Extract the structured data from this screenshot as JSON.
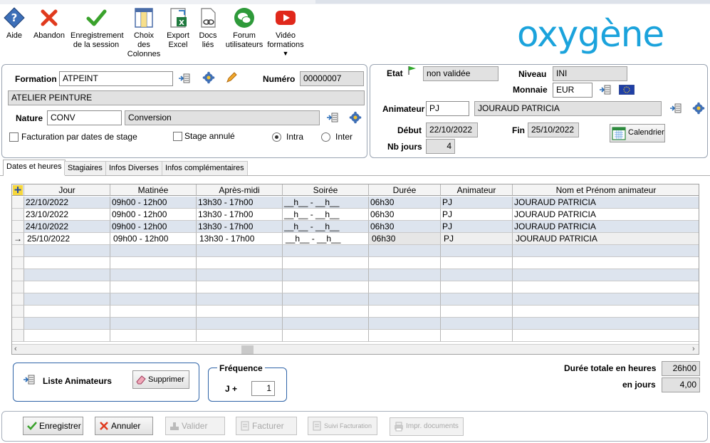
{
  "toolbar": {
    "items": [
      {
        "label": "Aide",
        "icon": "help-icon"
      },
      {
        "label": "Abandon",
        "icon": "close-icon"
      },
      {
        "label": "Enregistrement\nde la session",
        "icon": "check-icon"
      },
      {
        "label": "Choix\ndes\nColonnes",
        "icon": "columns-icon"
      },
      {
        "label": "Export\nExcel",
        "icon": "excel-icon"
      },
      {
        "label": "Docs\nliés",
        "icon": "linked-docs-icon"
      },
      {
        "label": "Forum\nutilisateurs",
        "icon": "forum-icon"
      },
      {
        "label": "Vidéo\nformations",
        "icon": "video-icon"
      }
    ],
    "logo": "oxygène"
  },
  "left_panel": {
    "formation_label": "Formation",
    "formation_value": "ATPEINT",
    "numero_label": "Numéro",
    "numero_value": "00000007",
    "formation_name": "ATELIER PEINTURE",
    "nature_label": "Nature",
    "nature_code": "CONV",
    "nature_name": "Conversion",
    "facturation_label": "Facturation par dates de stage",
    "stage_annule_label": "Stage annulé",
    "intra_label": "Intra",
    "inter_label": "Inter",
    "mode_selected": "Intra"
  },
  "right_panel": {
    "etat_label": "Etat",
    "etat_value": "non validée",
    "niveau_label": "Niveau",
    "niveau_value": "INI",
    "monnaie_label": "Monnaie",
    "monnaie_value": "EUR",
    "animateur_label": "Animateur",
    "animateur_code": "PJ",
    "animateur_name": "JOURAUD PATRICIA",
    "debut_label": "Début",
    "debut_value": "22/10/2022",
    "fin_label": "Fin",
    "fin_value": "25/10/2022",
    "calendrier_label": "Calendrier",
    "nbjours_label": "Nb jours",
    "nbjours_value": "4"
  },
  "tabs": [
    {
      "label": "Dates et heures",
      "active": true
    },
    {
      "label": "Stagiaires",
      "active": false
    },
    {
      "label": "Infos Diverses",
      "active": false
    },
    {
      "label": "Infos complémentaires",
      "active": false
    }
  ],
  "grid": {
    "columns": [
      "Jour",
      "Matinée",
      "Après-midi",
      "Soirée",
      "Durée",
      "Animateur",
      "Nom et Prénom animateur"
    ],
    "rows": [
      [
        "22/10/2022",
        "09h00 - 12h00",
        "13h30 - 17h00",
        "__h__ - __h__",
        "06h30",
        "PJ",
        "JOURAUD PATRICIA"
      ],
      [
        "23/10/2022",
        "09h00 - 12h00",
        "13h30 - 17h00",
        "__h__ - __h__",
        "06h30",
        "PJ",
        "JOURAUD PATRICIA"
      ],
      [
        "24/10/2022",
        "09h00 - 12h00",
        "13h30 - 17h00",
        "__h__ - __h__",
        "06h30",
        "PJ",
        "JOURAUD PATRICIA"
      ],
      [
        "25/10/2022",
        "09h00 - 12h00",
        "13h30 - 17h00",
        "__h__ - __h__",
        "06h30",
        "PJ",
        "JOURAUD PATRICIA"
      ]
    ],
    "current_row_indicator": "→"
  },
  "footer_panel": {
    "liste_animateurs_label": "Liste Animateurs",
    "supprimer_label": "Supprimer",
    "frequence_label": "Fréquence",
    "jplus_label": "J +",
    "jplus_value": "1",
    "duree_totale_label": "Durée totale en heures",
    "duree_totale_value": "26h00",
    "en_jours_label": "en jours",
    "en_jours_value": "4,00"
  },
  "actions": {
    "enregistrer": "Enregistrer",
    "annuler": "Annuler",
    "valider": "Valider",
    "facturer": "Facturer",
    "suivi_facturation": "Suivi Facturation",
    "impr_documents": "Impr. documents"
  },
  "colors": {
    "accent": "#1ba3dc",
    "row_alt": "#dde4ee",
    "disabled_text": "#a8a8a8"
  }
}
